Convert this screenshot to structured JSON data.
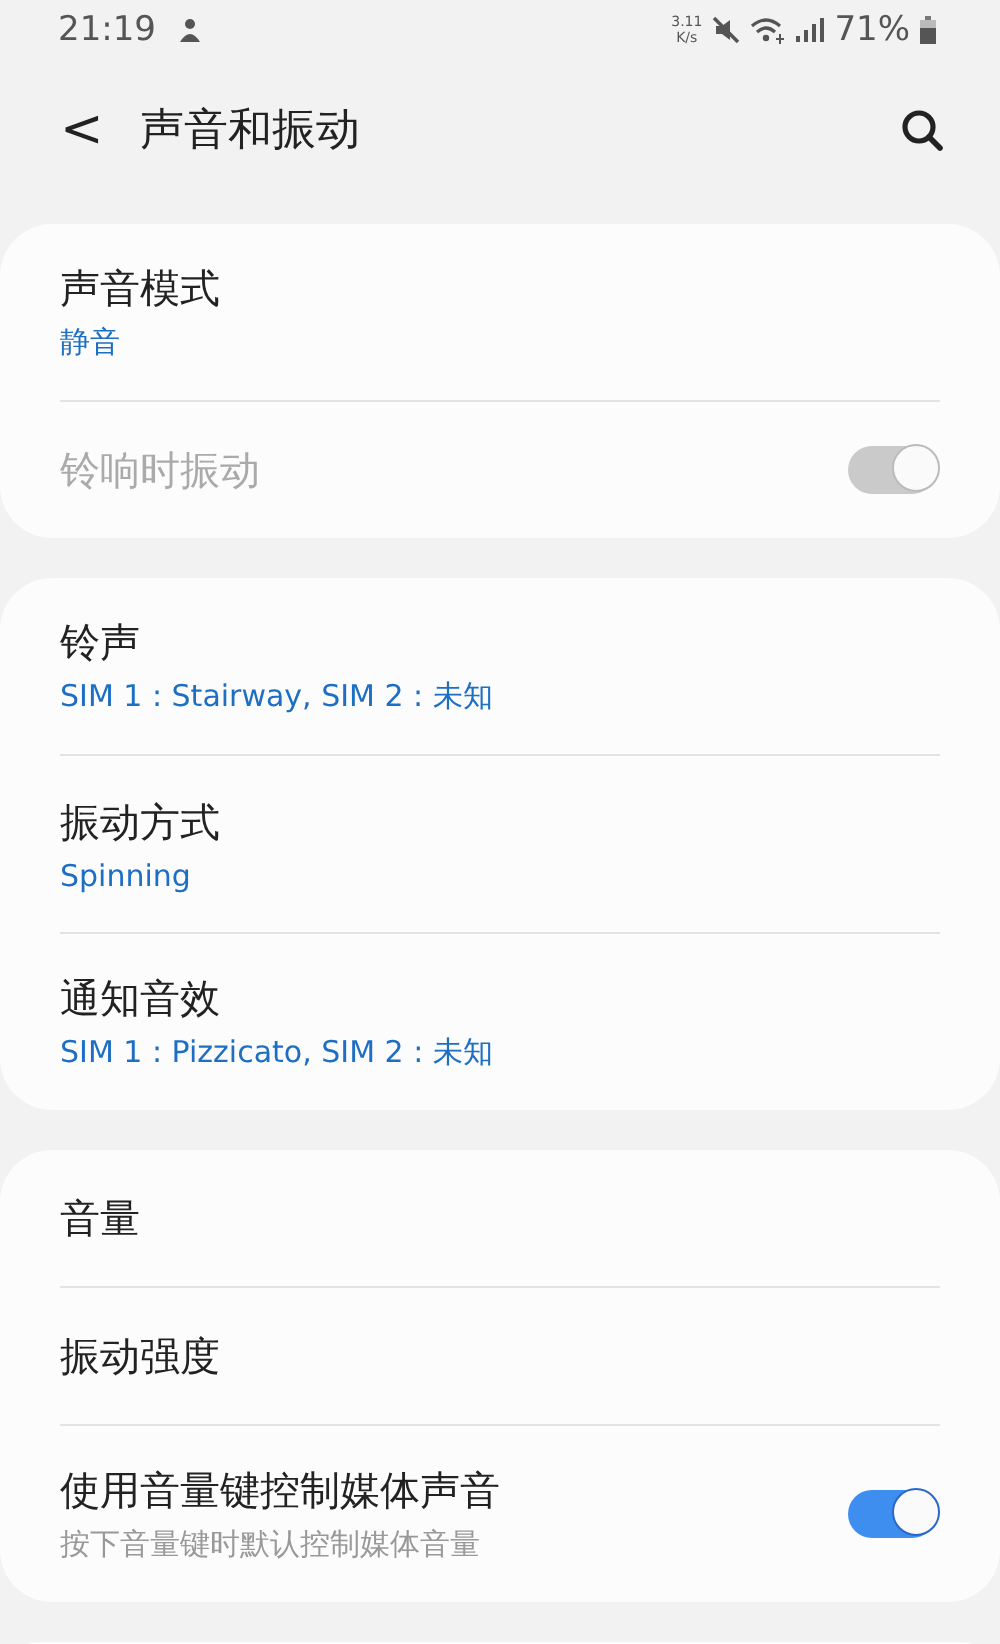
{
  "status_bar": {
    "time": "21:19",
    "speed_value": "3.11",
    "speed_unit": "K/s",
    "battery": "71%"
  },
  "header": {
    "back": "<",
    "title": "声音和振动"
  },
  "cards": [
    {
      "rows": [
        {
          "kind": "value",
          "title": "声音模式",
          "subtitle": "静音",
          "disabled": false
        },
        {
          "kind": "plain",
          "title": "铃响时振动",
          "disabled": true,
          "toggle": {
            "on": true
          }
        }
      ]
    },
    {
      "rows": [
        {
          "kind": "value",
          "title": "铃声",
          "subtitle": "SIM 1 : Stairway, SIM 2 : 未知",
          "disabled": false
        },
        {
          "kind": "value",
          "title": "振动方式",
          "subtitle": "Spinning",
          "disabled": false
        },
        {
          "kind": "value",
          "title": "通知音效",
          "subtitle": "SIM 1 : Pizzicato, SIM 2 : 未知",
          "disabled": false
        }
      ]
    },
    {
      "rows": [
        {
          "kind": "plain",
          "title": "音量",
          "disabled": false
        },
        {
          "kind": "plain",
          "title": "振动强度",
          "disabled": false
        },
        {
          "kind": "description",
          "title": "使用音量键控制媒体声音",
          "subtitle": "按下音量键时默认控制媒体音量",
          "disabled": false,
          "toggle": {
            "on": true
          }
        }
      ]
    }
  ]
}
